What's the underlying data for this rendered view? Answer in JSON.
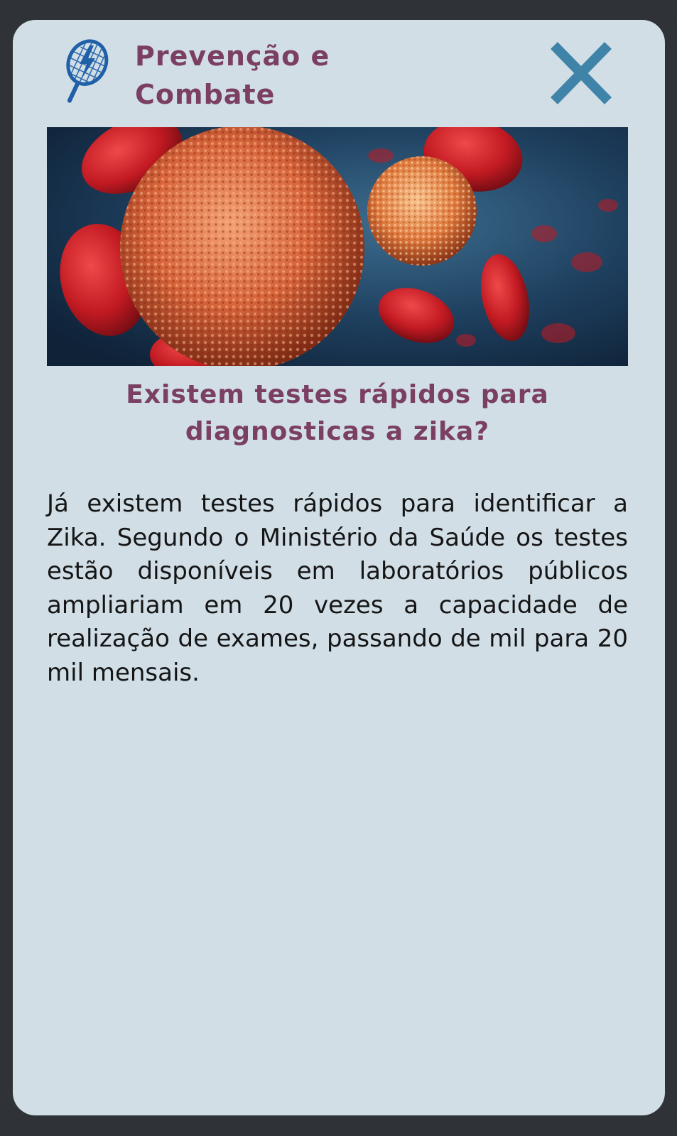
{
  "header": {
    "title": "Prevenção e Combate",
    "icon": "racket-lightning-icon",
    "close_icon": "close-icon"
  },
  "hero_image": {
    "alt": "",
    "subject": "virus-cells-illustration"
  },
  "question": "Existem testes rápidos para diagnosticas a zika?",
  "answer": "Já existem testes rápidos para identificar a Zika. Segundo o Ministério da Saúde os testes estão disponíveis em laboratórios públicos ampliariam em 20 vezes a capacidade de realização de exames, passando de mil para 20 mil mensais.",
  "colors": {
    "frame": "#2f3337",
    "card": "#d1dee6",
    "title": "#7a3f63",
    "close": "#3f84a8",
    "icon": "#1f60a8"
  }
}
